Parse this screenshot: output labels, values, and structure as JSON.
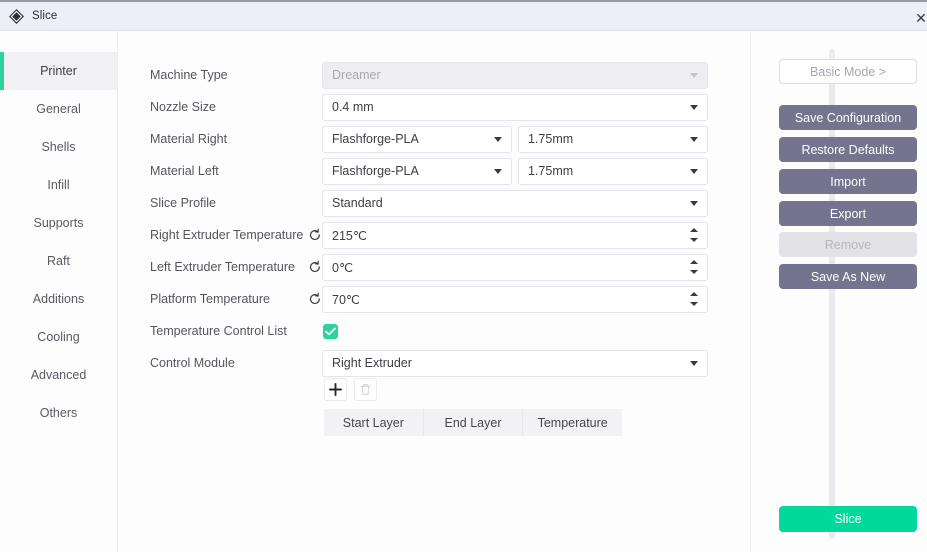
{
  "window": {
    "title": "Slice",
    "icon": "diamond-logo-icon",
    "close_label": "✕"
  },
  "sidebar": {
    "items": [
      {
        "label": "Printer",
        "active": true
      },
      {
        "label": "General",
        "active": false
      },
      {
        "label": "Shells",
        "active": false
      },
      {
        "label": "Infill",
        "active": false
      },
      {
        "label": "Supports",
        "active": false
      },
      {
        "label": "Raft",
        "active": false
      },
      {
        "label": "Additions",
        "active": false
      },
      {
        "label": "Cooling",
        "active": false
      },
      {
        "label": "Advanced",
        "active": false
      },
      {
        "label": "Others",
        "active": false
      }
    ]
  },
  "form": {
    "machine_type": {
      "label": "Machine Type",
      "value": "Dreamer",
      "disabled": true
    },
    "nozzle_size": {
      "label": "Nozzle Size",
      "value": "0.4 mm"
    },
    "material_right": {
      "label": "Material Right",
      "value": "Flashforge-PLA",
      "diameter": "1.75mm"
    },
    "material_left": {
      "label": "Material Left",
      "value": "Flashforge-PLA",
      "diameter": "1.75mm"
    },
    "slice_profile": {
      "label": "Slice Profile",
      "value": "Standard"
    },
    "right_temp": {
      "label": "Right Extruder Temperature",
      "value": "215℃"
    },
    "left_temp": {
      "label": "Left Extruder Temperature",
      "value": "0℃"
    },
    "platform_temp": {
      "label": "Platform Temperature",
      "value": "70℃"
    },
    "temp_control": {
      "label": "Temperature Control List",
      "checked": true
    },
    "control_module": {
      "label": "Control Module",
      "value": "Right Extruder"
    }
  },
  "table_actions": {
    "add": "+",
    "delete": "trash-icon"
  },
  "table": {
    "columns": [
      "Start Layer",
      "End Layer",
      "Temperature"
    ],
    "rows": []
  },
  "actions": {
    "basic_mode": "Basic Mode  >",
    "save_configuration": "Save Configuration",
    "restore_defaults": "Restore Defaults",
    "import": "Import",
    "export": "Export",
    "remove": "Remove",
    "save_as_new": "Save As New",
    "slice": "Slice"
  },
  "colors": {
    "accent_green": "#2ed29b",
    "slice_green": "#00d99b",
    "button_purple": "#74748f",
    "disabled_gray": "#e2e2e7"
  }
}
